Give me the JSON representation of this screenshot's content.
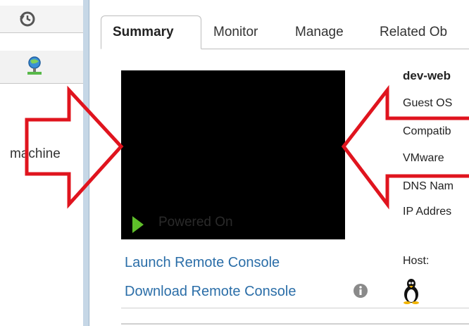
{
  "left_pane": {
    "label_text": "machine",
    "icons": [
      "history-icon",
      "network-icon"
    ]
  },
  "tabs": [
    {
      "label": "Summary",
      "active": true
    },
    {
      "label": "Monitor",
      "active": false
    },
    {
      "label": "Manage",
      "active": false
    },
    {
      "label": "Related Ob",
      "active": false
    }
  ],
  "console": {
    "status_text": "Powered On"
  },
  "links": {
    "launch": "Launch Remote Console",
    "download": "Download Remote Console"
  },
  "vm_properties": {
    "name": "dev-web",
    "guest_os_label": "Guest OS",
    "compatibility_label": "Compatib",
    "vmware_label": "VMware",
    "dns_label": "DNS Nam",
    "ip_label": "IP Addres"
  },
  "host_label": "Host:",
  "colors": {
    "link": "#2b6ea8",
    "arrow": "#e0141e",
    "power": "#5fbf2a",
    "splitter": "#c6d7e6"
  }
}
